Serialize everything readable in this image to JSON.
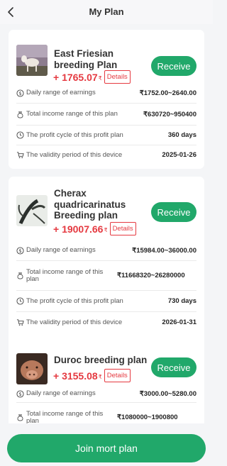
{
  "header": {
    "title": "My Plan",
    "back_icon": "chevron-left-icon"
  },
  "plans": [
    {
      "name": "East Friesian breeding Plan",
      "price": "+ 1765.07",
      "currency": "₹",
      "details_label": "Details",
      "receive_label": "Receive",
      "rows": [
        {
          "icon": "dollar-circle-icon",
          "label": "Daily range of earnings",
          "value": "₹1752.00~2640.00"
        },
        {
          "icon": "money-bag-icon",
          "label": "Total income range of this plan",
          "value": "₹630720~950400"
        },
        {
          "icon": "clock-icon",
          "label": "The profit cycle of this profit plan",
          "value": "360 days"
        },
        {
          "icon": "cart-icon",
          "label": "The validity period of this device",
          "value": "2025-01-26"
        }
      ]
    },
    {
      "name": "Cherax quadricarinatus Breeding plan",
      "price": "+ 19007.66",
      "currency": "₹",
      "details_label": "Details",
      "receive_label": "Receive",
      "rows": [
        {
          "icon": "dollar-circle-icon",
          "label": "Daily range of earnings",
          "value": "₹15984.00~36000.00"
        },
        {
          "icon": "money-bag-icon",
          "label": "Total income range of this plan",
          "value": "₹11668320~26280000"
        },
        {
          "icon": "clock-icon",
          "label": "The profit cycle of this profit plan",
          "value": "730 days"
        },
        {
          "icon": "cart-icon",
          "label": "The validity period of this device",
          "value": "2026-01-31"
        }
      ]
    },
    {
      "name": "Duroc breeding plan",
      "price": "+ 3155.08",
      "currency": "₹",
      "details_label": "Details",
      "receive_label": "Receive",
      "rows": [
        {
          "icon": "dollar-circle-icon",
          "label": "Daily range of earnings",
          "value": "₹3000.00~5280.00"
        },
        {
          "icon": "money-bag-icon",
          "label": "Total income range of this plan",
          "value": "₹1080000~1900800"
        }
      ]
    }
  ],
  "join_label": "Join mort plan",
  "colors": {
    "accent": "#21a86a",
    "price": "#e53940",
    "background": "#f4f5f7"
  }
}
